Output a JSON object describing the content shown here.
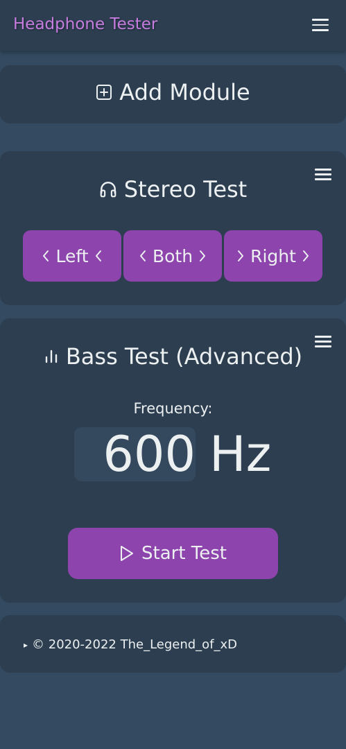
{
  "header": {
    "title": "Headphone Tester",
    "menu_icon": "hamburger-menu-icon"
  },
  "add_module": {
    "icon": "plus-square-icon",
    "label": "Add Module"
  },
  "stereo_test": {
    "icon": "headphones-icon",
    "title": "Stereo Test",
    "menu_icon": "hamburger-menu-icon",
    "buttons": [
      {
        "label": "Left",
        "icons": [
          "chevron-left-icon",
          "chevron-left-icon"
        ]
      },
      {
        "label": "Both",
        "icons": [
          "chevron-left-icon",
          "chevron-right-icon"
        ]
      },
      {
        "label": "Right",
        "icons": [
          "chevron-right-icon",
          "chevron-right-icon"
        ]
      }
    ]
  },
  "bass_test": {
    "icon": "bar-chart-icon",
    "title": "Bass Test (Advanced)",
    "menu_icon": "hamburger-menu-icon",
    "frequency_label": "Frequency:",
    "frequency_value": "600",
    "frequency_unit": "Hz",
    "start_button": {
      "icon": "play-icon",
      "label": "Start Test"
    }
  },
  "footer": {
    "disclosure_icon": "triangle-right-icon",
    "text": "© 2020-2022 The_Legend_of_xD"
  },
  "colors": {
    "background": "#334a60",
    "card": "#2c3e50",
    "accent": "#8e44ad",
    "brand": "#c77ddf",
    "text": "#ecf0f1",
    "input_bg": "#34495e"
  }
}
